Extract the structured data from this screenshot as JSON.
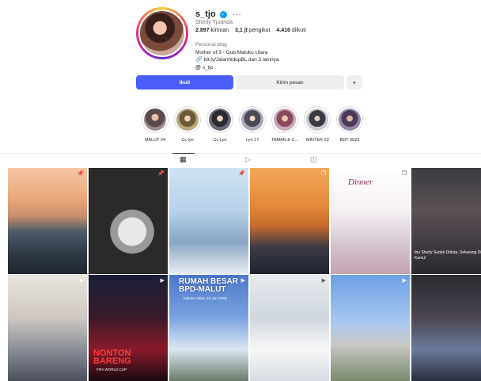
{
  "profile": {
    "username": "s_tjo",
    "full_name": "Sherly Tjoanda",
    "stats": {
      "posts_value": "2.897",
      "posts_label": "kiriman",
      "followers_value": "3,1 jt",
      "followers_label": "pengikut",
      "following_value": "4.416",
      "following_label": "diikuti"
    },
    "bio": {
      "category": "Personal blog",
      "line1": "Mother of 3 - Gub Maluku Utara",
      "link": "bit.ly/JalanhidupBL dan 3 lainnya",
      "threads": "s_tjo"
    }
  },
  "buttons": {
    "follow": "Ikuti",
    "message": "Kirim pesan",
    "suggest_icon": "add-person-icon"
  },
  "highlights": [
    {
      "label": "MALUT 24"
    },
    {
      "label": "Cc lyn"
    },
    {
      "label": "Cc Lyn"
    },
    {
      "label": "Lyn 17"
    },
    {
      "label": "TAMAN & C..."
    },
    {
      "label": "WINTER 23"
    },
    {
      "label": "BDT 2023"
    }
  ],
  "tabs": {
    "posts_icon": "grid-icon",
    "reels_icon": "reels-icon",
    "tagged_icon": "tagged-icon"
  },
  "posts": [
    {
      "kind": "photo"
    },
    {
      "kind": "photo"
    },
    {
      "kind": "photo"
    },
    {
      "kind": "photo"
    },
    {
      "kind": "photo",
      "overlay": "Dinner"
    },
    {
      "kind": "reel",
      "overlay": "Ibu Sherly Sudah Diduta, Sekarang Diiman Kamu!"
    },
    {
      "kind": "reel"
    },
    {
      "kind": "reel",
      "overlay": "NONTON BARENG",
      "overlay_sub": "FIFA WORLD CUP"
    },
    {
      "kind": "reel",
      "overlay": "RUMAH BESAR BPD-MALUT",
      "overlay_sub": "Maluku Utara, 18 Juni 2025"
    },
    {
      "kind": "reel"
    },
    {
      "kind": "reel"
    },
    {
      "kind": "reel"
    }
  ],
  "colors": {
    "follow_button": "#4a5df9",
    "verified_badge": "#0095f6",
    "text_primary": "#262626",
    "text_secondary": "#737373"
  }
}
